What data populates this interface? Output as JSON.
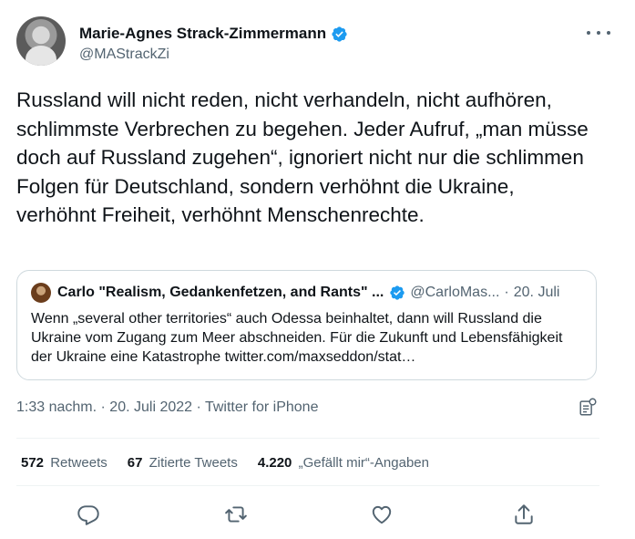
{
  "author": {
    "display_name": "Marie-Agnes Strack-Zimmermann",
    "handle": "@MAStrackZi",
    "verified": true
  },
  "tweet": {
    "text": "Russland will nicht reden, nicht verhandeln, nicht aufhören, schlimmste Verbrechen zu begehen. Jeder Aufruf, „man müsse doch auf Russland zugehen“, ignoriert nicht nur die schlimmen Folgen für Deutschland, sondern verhöhnt die Ukraine, verhöhnt Freiheit, verhöhnt Menschenrechte."
  },
  "quote": {
    "display_name": "Carlo \"Realism, Gedankenfetzen, and Rants\" ...",
    "handle": "@CarloMas...",
    "separator": "·",
    "date": "20. Juli",
    "text": "Wenn „several other territories“ auch Odessa beinhaltet, dann will Russland die Ukraine vom Zugang zum Meer abschneiden. Für die Zukunft und Lebensfähigkeit der Ukraine eine Katastrophe twitter.com/maxseddon/stat…"
  },
  "meta": {
    "time": "1:33 nachm.",
    "dot1": "·",
    "date": "20. Juli 2022",
    "dot2": "·",
    "source": "Twitter for iPhone"
  },
  "stats": {
    "retweets_count": "572",
    "retweets_label": "Retweets",
    "quotes_count": "67",
    "quotes_label": "Zitierte Tweets",
    "likes_count": "4.220",
    "likes_label": "„Gefällt mir“-Angaben"
  },
  "icons": {
    "verified": "verified-badge-icon",
    "more": "more-icon",
    "analytics": "analytics-icon",
    "reply": "reply-icon",
    "retweet": "retweet-icon",
    "like": "heart-icon",
    "share": "share-icon"
  },
  "colors": {
    "primary_text": "#0f1419",
    "secondary_text": "#536471",
    "verified_blue": "#1d9bf0",
    "border": "#cfd9de",
    "divider": "#eff3f4"
  }
}
